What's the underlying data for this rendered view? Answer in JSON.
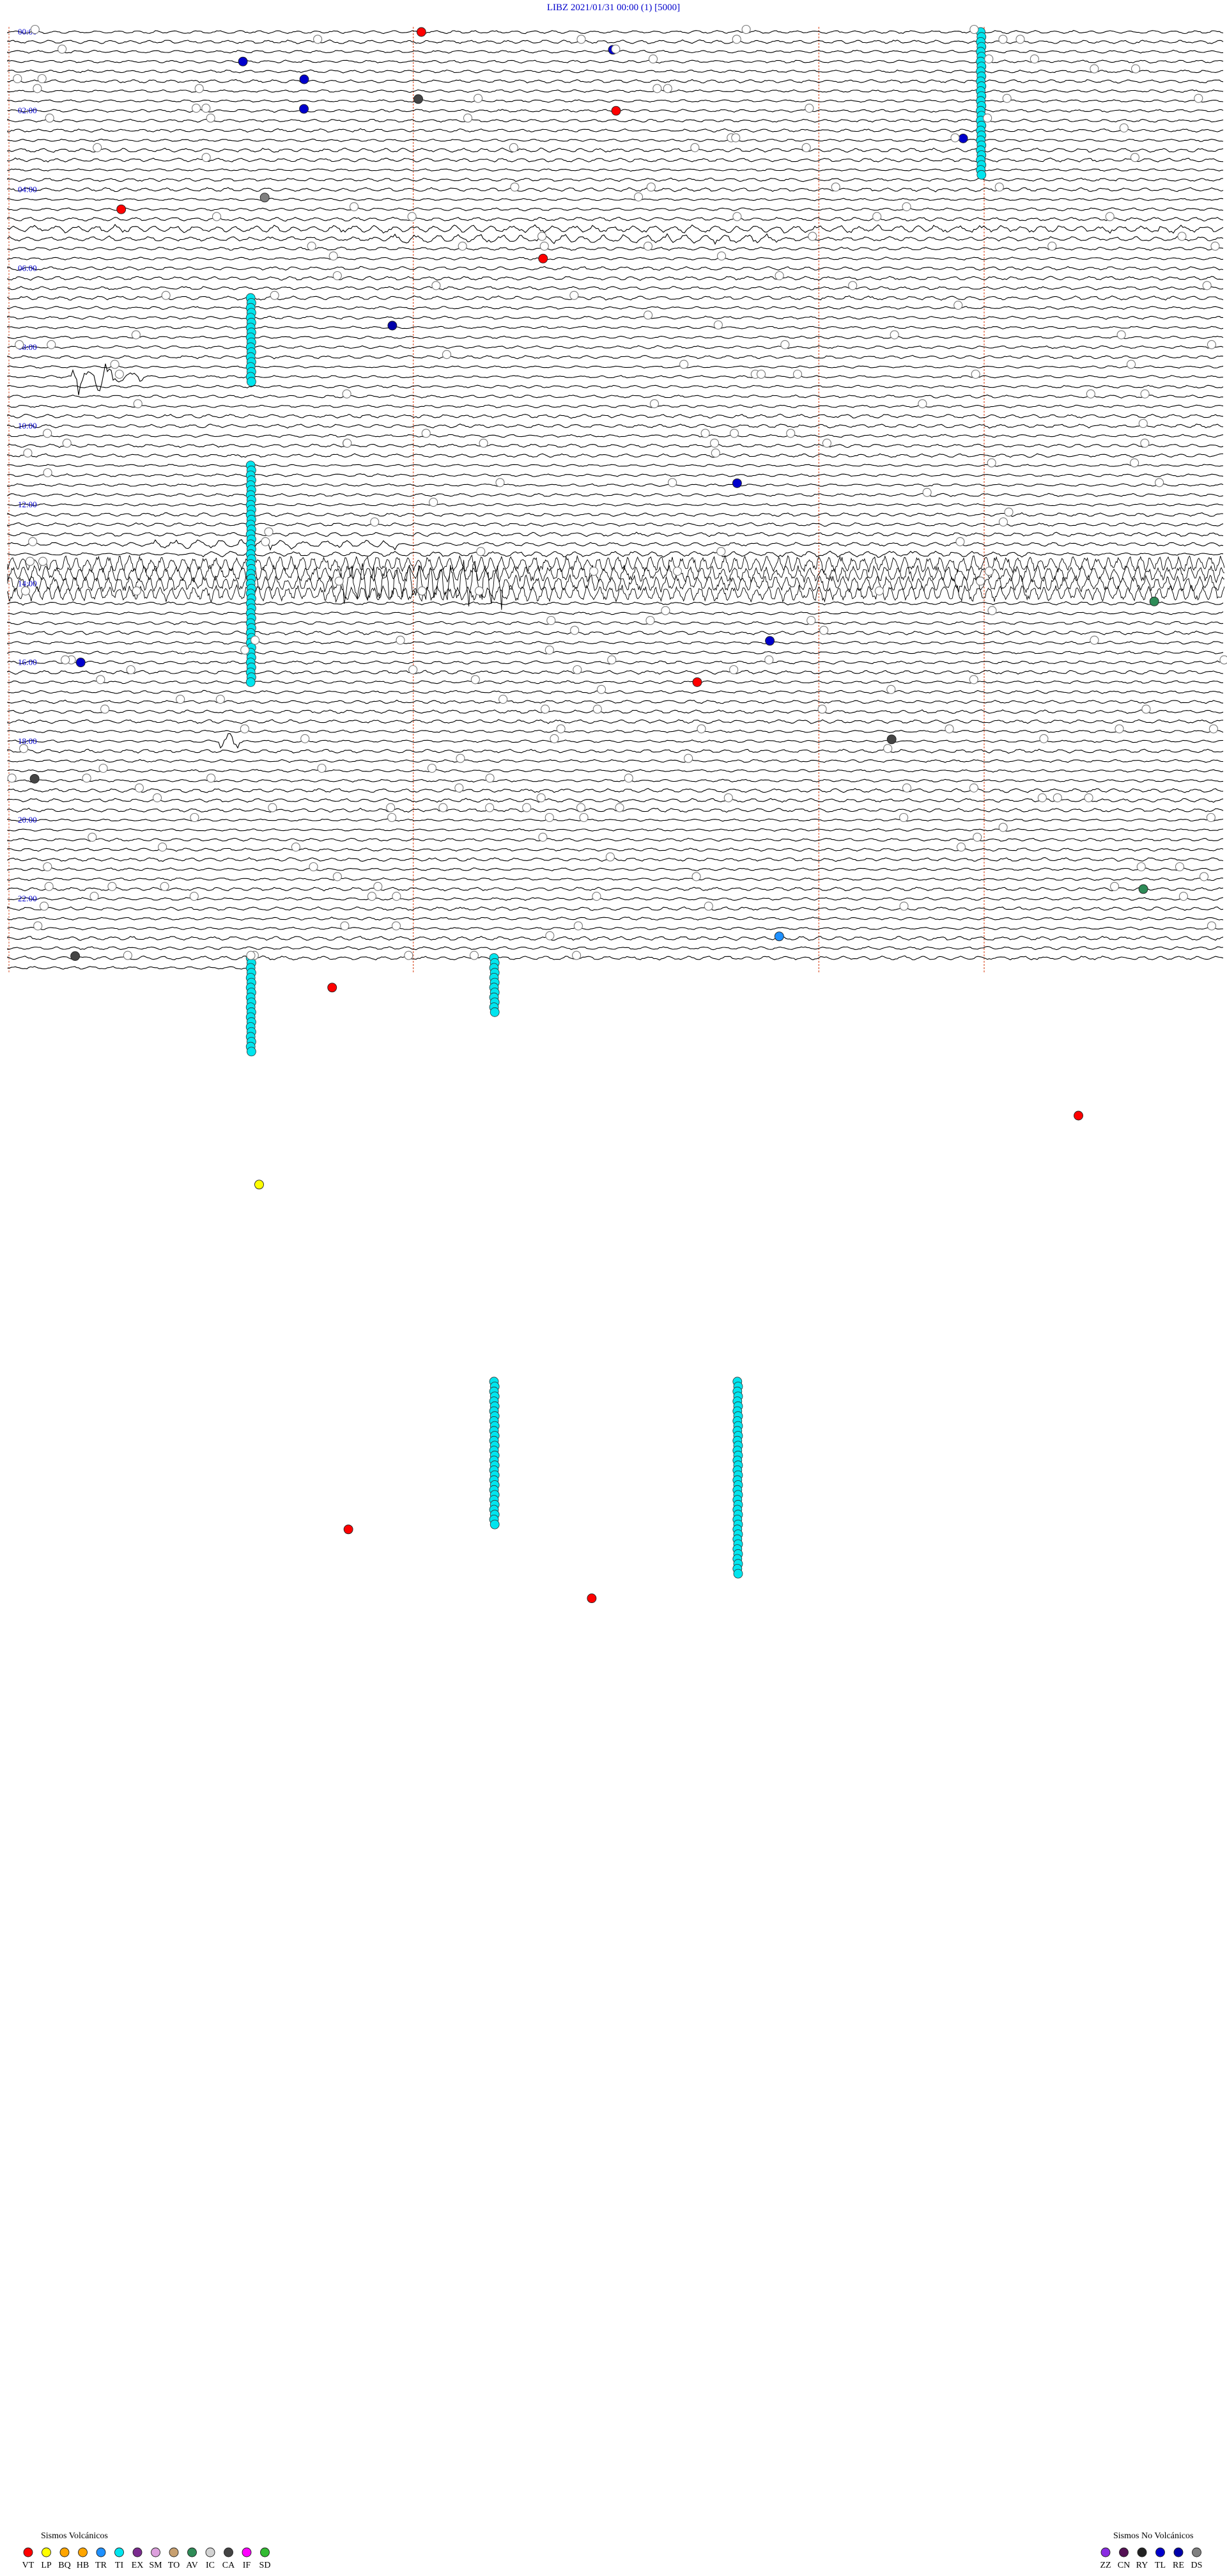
{
  "header": {
    "station": "LIBZ",
    "datetime": "2021/01/31 00:00",
    "channel": "(1)",
    "scale": "[5000]"
  },
  "chart_data": {
    "type": "helicorder",
    "traces_per_hour": 4,
    "hours": 24,
    "minutes_per_trace": 15,
    "hour_labels": [
      "00:00",
      "02:00",
      "04:00",
      "06:00",
      "08:00",
      "10:00",
      "12:00",
      "14:00",
      "16:00",
      "18:00",
      "20:00",
      "22:00"
    ],
    "minute_marks": [
      5,
      10,
      15
    ],
    "colors": {
      "trace": "#000000",
      "hour_label": "#0000cc",
      "minute_mark": "#e07050",
      "VT": "#ff0000",
      "LP": "#ffff00",
      "BQ": "#ffa500",
      "HB": "#ffa500",
      "TR": "#1e90ff",
      "TI": "#00e5ee",
      "EX": "#7b2b8f",
      "SM": "#dda0dd",
      "TO": "#c8a070",
      "AV": "#2e8b57",
      "IC": "#d3d3d3",
      "CA": "#444444",
      "IF": "#ff00ff",
      "SD": "#33bb33",
      "ZZ": "#8a2be2",
      "CN": "#551155",
      "RY": "#222222",
      "TL": "#0000cc",
      "RE": "#0000aa",
      "DS": "#808080"
    },
    "legend_volcanic": {
      "title": "Sismos Volcánicos",
      "codes": [
        "VT",
        "LP",
        "BQ",
        "HB",
        "TR",
        "TI",
        "EX",
        "SM",
        "TO",
        "AV",
        "IC",
        "CA",
        "IF",
        "SD"
      ]
    },
    "legend_non_volcanic": {
      "title": "Sismos No Volcánicos",
      "codes": [
        "ZZ",
        "CN",
        "RY",
        "TL",
        "RE",
        "DS"
      ]
    },
    "ti_swarms": [
      {
        "trace": 0,
        "minute": 12.0,
        "span": 30
      },
      {
        "trace": 27,
        "minute": 3.0,
        "span": 18
      },
      {
        "trace": 44,
        "minute": 3.0,
        "span": 45
      },
      {
        "trace": 94,
        "minute": 3.0,
        "span": 20
      },
      {
        "trace": 94,
        "minute": 6.0,
        "span": 12
      },
      {
        "trace": 137,
        "minute": 6.0,
        "span": 30
      },
      {
        "trace": 137,
        "minute": 9.0,
        "span": 40
      }
    ],
    "events_sample": [
      {
        "trace": 0,
        "minute": 5.1,
        "type": "VT"
      },
      {
        "trace": 3,
        "minute": 2.9,
        "type": "TL"
      },
      {
        "trace": 8,
        "minute": 7.5,
        "type": "VT"
      },
      {
        "trace": 18,
        "minute": 1.4,
        "type": "VT"
      },
      {
        "trace": 23,
        "minute": 6.6,
        "type": "VT"
      },
      {
        "trace": 64,
        "minute": 0.9,
        "type": "TL"
      },
      {
        "trace": 66,
        "minute": 8.5,
        "type": "VT"
      },
      {
        "trace": 87,
        "minute": 14.0,
        "type": "AV"
      },
      {
        "trace": 97,
        "minute": 4.0,
        "type": "VT"
      },
      {
        "trace": 110,
        "minute": 13.2,
        "type": "VT"
      },
      {
        "trace": 117,
        "minute": 3.1,
        "type": "LP"
      },
      {
        "trace": 152,
        "minute": 4.2,
        "type": "VT"
      },
      {
        "trace": 159,
        "minute": 7.2,
        "type": "VT"
      }
    ]
  }
}
